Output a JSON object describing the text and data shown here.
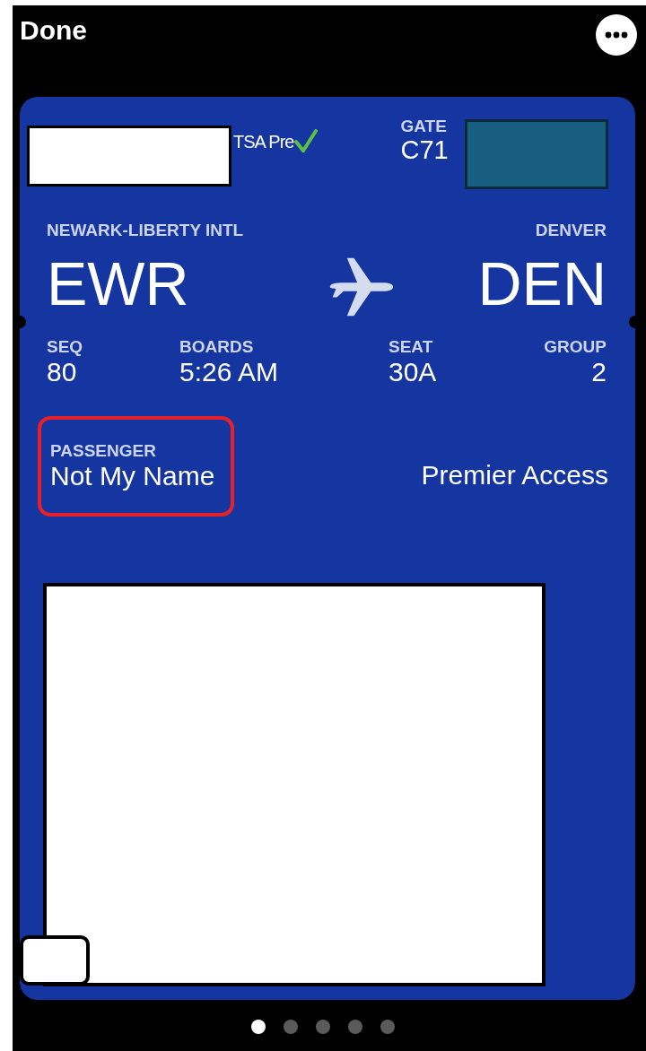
{
  "header": {
    "done": "Done"
  },
  "pass": {
    "tsa": "TSA Pre",
    "gate": {
      "label": "GATE",
      "value": "C71"
    },
    "origin": {
      "name": "NEWARK-LIBERTY INTL",
      "code": "EWR"
    },
    "destination": {
      "name": "DENVER",
      "code": "DEN"
    },
    "fields": [
      {
        "label": "SEQ",
        "value": "80"
      },
      {
        "label": "BOARDS",
        "value": "5:26 AM"
      },
      {
        "label": "SEAT",
        "value": "30A"
      },
      {
        "label": "GROUP",
        "value": "2"
      }
    ],
    "passenger": {
      "label": "PASSENGER",
      "value": "Not My Name",
      "highlighted": true
    },
    "access": "Premier Access"
  },
  "pages": [
    {
      "selected": true
    },
    {
      "selected": false
    },
    {
      "selected": false
    },
    {
      "selected": false
    },
    {
      "selected": false
    }
  ]
}
